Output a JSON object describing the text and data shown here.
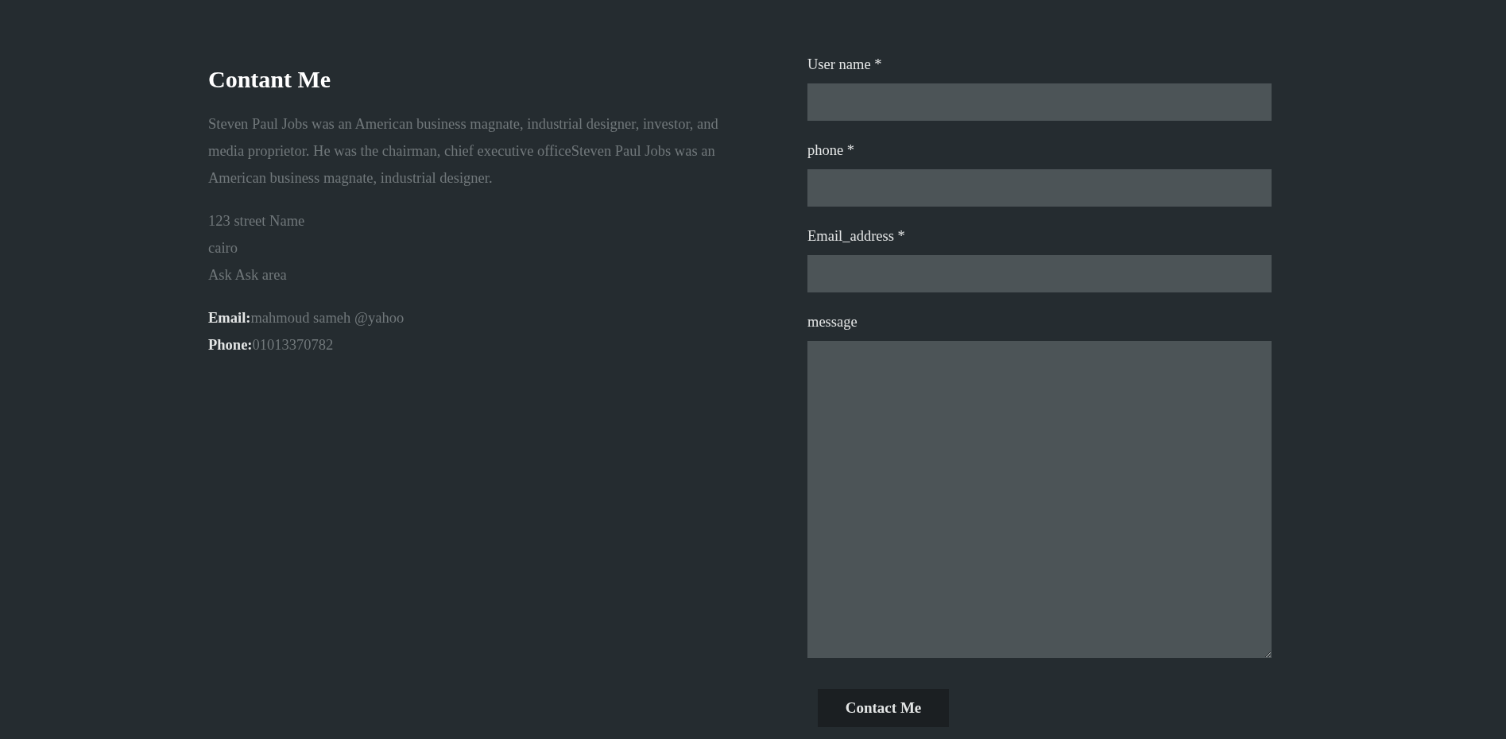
{
  "contact_info": {
    "heading": "Contant Me",
    "description": "Steven Paul Jobs was an American business magnate, industrial designer, investor, and media proprietor. He was the chairman, chief executive officeSteven Paul Jobs was an American business magnate, industrial designer.",
    "address_lines": [
      "123 street Name",
      "cairo",
      "Ask Ask area"
    ],
    "details": [
      {
        "label": "Email:",
        "value": "mahmoud sameh @yahoo"
      },
      {
        "label": "Phone:",
        "value": "01013370782"
      }
    ]
  },
  "form": {
    "fields": [
      {
        "label": "User name *",
        "kind": "input"
      },
      {
        "label": "phone *",
        "kind": "input"
      },
      {
        "label": "Email_address *",
        "kind": "input"
      },
      {
        "label": "message",
        "kind": "textarea"
      }
    ],
    "submit_button": "Contact Me"
  }
}
